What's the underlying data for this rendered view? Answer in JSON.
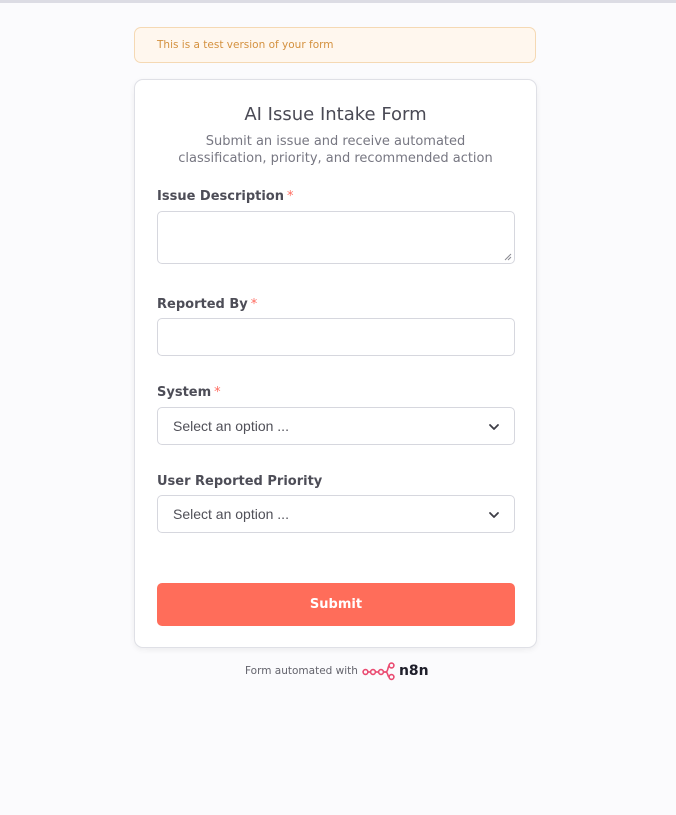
{
  "banner": {
    "text": "This is a test version of your form"
  },
  "form": {
    "title": "AI Issue Intake Form",
    "subtitle": "Submit an issue and receive automated classification, priority, and recommended action",
    "fields": [
      {
        "label": "Issue Description",
        "required": true,
        "type": "textarea",
        "value": ""
      },
      {
        "label": "Reported By",
        "required": true,
        "type": "text",
        "value": ""
      },
      {
        "label": "System",
        "required": true,
        "type": "select",
        "selected": "Select an option ..."
      },
      {
        "label": "User Reported Priority",
        "required": false,
        "type": "select",
        "selected": "Select an option ..."
      }
    ],
    "required_marker": "*",
    "submit_label": "Submit"
  },
  "footer": {
    "text": "Form automated with",
    "brand": "n8n",
    "brand_color": "#ea4b71"
  },
  "colors": {
    "accent": "#ff6d5a",
    "banner_bg": "#fff7ee",
    "banner_text": "#d4913f"
  },
  "icons": {
    "select_chevron": "chevron-down-icon",
    "brand_logo": "n8n-logo-icon"
  }
}
